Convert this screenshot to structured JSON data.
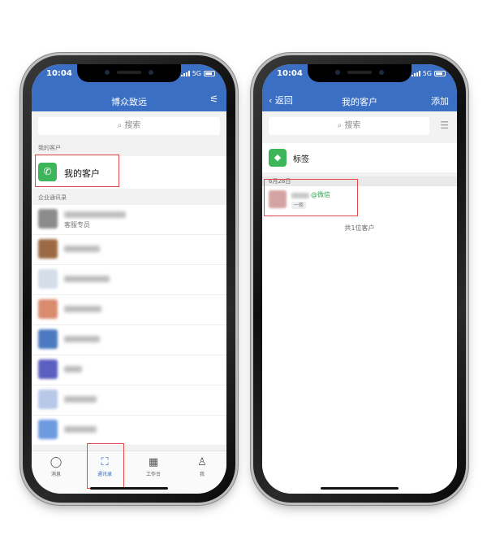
{
  "left": {
    "status": {
      "time": "10:04",
      "network": "5G"
    },
    "nav": {
      "title": "博众致远",
      "filter_icon": "sliders-icon"
    },
    "search": {
      "placeholder": "搜索"
    },
    "sections": {
      "my_customers": "我的客户",
      "enterprise_directory": "企业通讯录"
    },
    "my_customers_row": {
      "label": "我的客户"
    },
    "contacts": [
      {
        "subtitle": "客服专员",
        "avatar_color": "#8c8c8c"
      },
      {
        "subtitle": "",
        "avatar_color": "#9b6a44"
      },
      {
        "subtitle": "",
        "avatar_color": "#d4dde8"
      },
      {
        "subtitle": "",
        "avatar_color": "#d98b6d"
      },
      {
        "subtitle": "",
        "avatar_color": "#4b7ac0"
      },
      {
        "subtitle": "",
        "avatar_color": "#5b5fc0"
      },
      {
        "subtitle": "",
        "avatar_color": "#b8c8e8"
      },
      {
        "subtitle": "",
        "avatar_color": "#6e9ae0"
      }
    ],
    "tabs": [
      {
        "label": "消息",
        "icon": "chat-bubble-icon"
      },
      {
        "label": "通讯录",
        "icon": "org-chart-icon"
      },
      {
        "label": "工作台",
        "icon": "grid-icon"
      },
      {
        "label": "我",
        "icon": "person-icon"
      }
    ]
  },
  "right": {
    "status": {
      "time": "10:04",
      "network": "5G"
    },
    "nav": {
      "back_label": "返回",
      "title": "我的客户",
      "add_label": "添加"
    },
    "search": {
      "placeholder": "搜索"
    },
    "tag_row": {
      "label": "标签"
    },
    "date_header": "6月28日",
    "customer": {
      "source": "@微信",
      "tag": "一般"
    },
    "count_text": "共1位客户"
  },
  "colors": {
    "brand_blue": "#3a6fc4",
    "wechat_green": "#3db55a",
    "highlight_red": "#e34b4b"
  }
}
